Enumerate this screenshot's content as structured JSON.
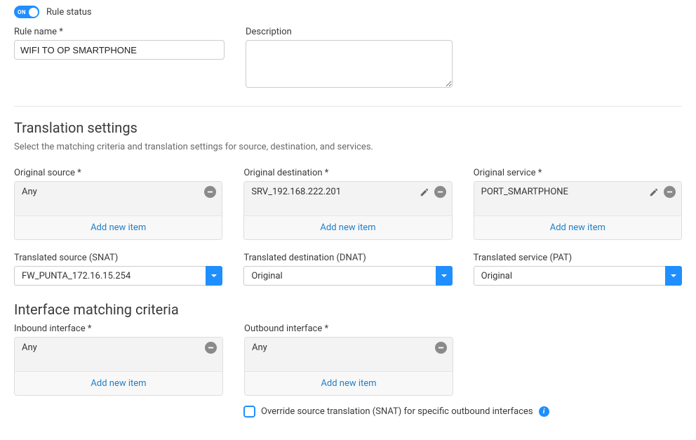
{
  "toggle": {
    "label": "Rule status",
    "on_text": "ON"
  },
  "rule_name": {
    "label": "Rule name *",
    "value": "WIFI TO OP SMARTPHONE"
  },
  "description": {
    "label": "Description",
    "value": ""
  },
  "translation": {
    "title": "Translation settings",
    "subtitle": "Select the matching criteria and translation settings for source, destination, and services.",
    "orig_source": {
      "label": "Original source *",
      "items": [
        "Any"
      ]
    },
    "orig_dest": {
      "label": "Original destination *",
      "items": [
        "SRV_192.168.222.201"
      ]
    },
    "orig_service": {
      "label": "Original service *",
      "items": [
        "PORT_SMARTPHONE"
      ]
    },
    "trans_source": {
      "label": "Translated source (SNAT)",
      "value": "FW_PUNTA_172.16.15.254"
    },
    "trans_dest": {
      "label": "Translated destination (DNAT)",
      "value": "Original"
    },
    "trans_service": {
      "label": "Translated service (PAT)",
      "value": "Original"
    },
    "add_new": "Add new item"
  },
  "iface": {
    "title": "Interface matching criteria",
    "inbound": {
      "label": "Inbound interface *",
      "items": [
        "Any"
      ]
    },
    "outbound": {
      "label": "Outbound interface *",
      "items": [
        "Any"
      ]
    }
  },
  "override": {
    "label": "Override source translation (SNAT) for specific outbound interfaces"
  }
}
